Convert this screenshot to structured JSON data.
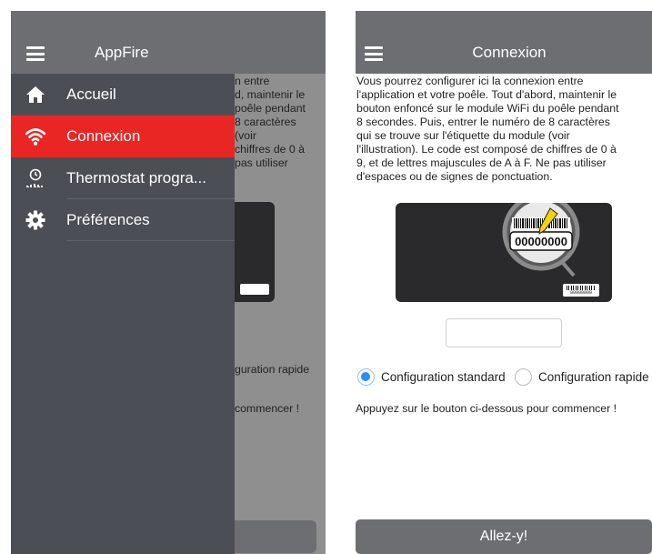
{
  "drawer": {
    "app_title": "AppFire",
    "items": [
      {
        "label": "Accueil",
        "icon": "home-icon"
      },
      {
        "label": "Connexion",
        "icon": "wifi-icon",
        "active": true
      },
      {
        "label": "Thermostat progra...",
        "icon": "thermostat-clock-icon"
      },
      {
        "label": "Préférences",
        "icon": "gear-icon"
      }
    ]
  },
  "background": {
    "text_fragment": "n entre\nd, maintenir le\npoêle pendant\n8 caractères\n(voir\nchiffres de 0 à\npas utiliser",
    "radio_fragment": "guration rapide",
    "hint_fragment": "commencer !"
  },
  "connexion": {
    "title": "Connexion",
    "instructions": "Vous pourrez configurer ici la connexion entre\nl'application et votre poêle. Tout d'abord, maintenir le\nbouton enfoncé sur le module WiFi du poêle pendant\n8 secondes. Puis, entrer le numéro de 8 caractères\nqui se trouve sur l'étiquette du module (voir\nl'illustration). Le code est composé de chiffres de 0 à\n9, et de lettres majuscules de A à F. Ne pas utiliser\nd'espaces ou de signes de ponctuation.",
    "illustration": {
      "zoom_code": "00000000",
      "label_code": "00000000"
    },
    "code_input": {
      "value": "",
      "placeholder": ""
    },
    "options": [
      {
        "label": "Configuration standard",
        "checked": true
      },
      {
        "label": "Configuration rapide",
        "checked": false
      }
    ],
    "hint": "Appuyez sur le bouton ci-dessous pour commencer !",
    "go_button": "Allez-y!"
  },
  "colors": {
    "header": "#6d6e72",
    "drawer_bg": "#4b4e54",
    "active_item": "#e92624",
    "radio_selected": "#2d8ef1",
    "card": "#2a2a2c",
    "arrow": "#f5d20a"
  }
}
